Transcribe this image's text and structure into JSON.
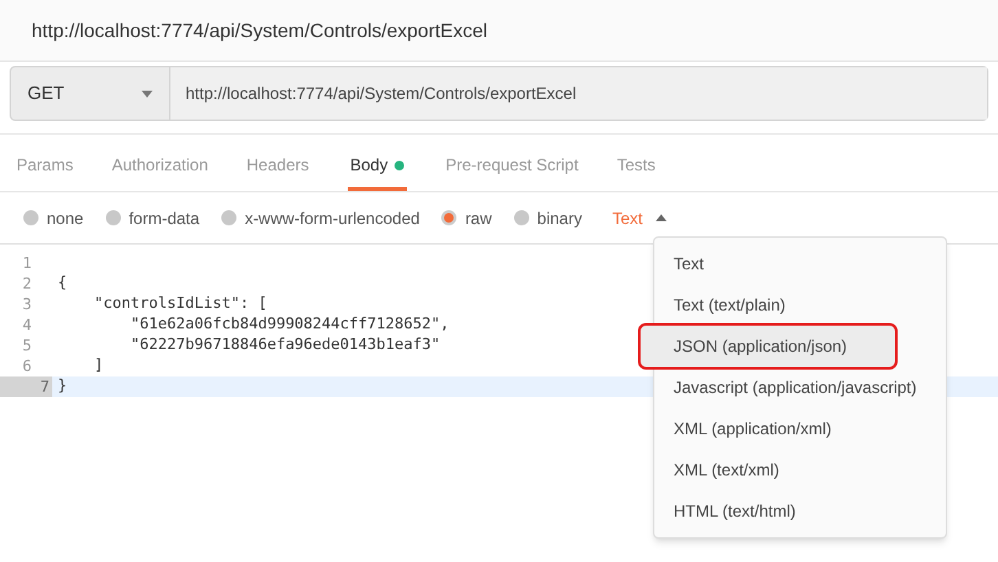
{
  "title": "http://localhost:7774/api/System/Controls/exportExcel",
  "request": {
    "method": "GET",
    "url": "http://localhost:7774/api/System/Controls/exportExcel"
  },
  "tabs": [
    {
      "label": "Params",
      "selected": false,
      "dot": false
    },
    {
      "label": "Authorization",
      "selected": false,
      "dot": false
    },
    {
      "label": "Headers",
      "selected": false,
      "dot": false
    },
    {
      "label": "Body",
      "selected": true,
      "dot": true
    },
    {
      "label": "Pre-request Script",
      "selected": false,
      "dot": false
    },
    {
      "label": "Tests",
      "selected": false,
      "dot": false
    }
  ],
  "body_types": [
    {
      "label": "none",
      "selected": false
    },
    {
      "label": "form-data",
      "selected": false
    },
    {
      "label": "x-www-form-urlencoded",
      "selected": false
    },
    {
      "label": "raw",
      "selected": true
    },
    {
      "label": "binary",
      "selected": false
    }
  ],
  "format_dropdown": {
    "value": "Text",
    "expanded": true
  },
  "editor": {
    "lines": [
      {
        "number": "1",
        "current": false
      },
      {
        "number": "2",
        "text": "{",
        "current": false
      },
      {
        "number": "3",
        "text": "    \"controlsIdList\": [",
        "current": false
      },
      {
        "number": "4",
        "text": "        \"61e62a06fcb84d99908244cff7128652\",",
        "current": false
      },
      {
        "number": "5",
        "text": "        \"62227b96718846efa96ede0143b1eaf3\"",
        "current": false
      },
      {
        "number": "6",
        "text": "    ]",
        "current": false
      },
      {
        "number": "7",
        "text": "}",
        "current": true
      }
    ]
  },
  "menu": [
    {
      "label": "Text",
      "highlighted": false
    },
    {
      "label": "Text (text/plain)",
      "highlighted": false
    },
    {
      "label": "JSON (application/json)",
      "highlighted": true
    },
    {
      "label": "Javascript (application/javascript)",
      "highlighted": false
    },
    {
      "label": "XML (application/xml)",
      "highlighted": false
    },
    {
      "label": "XML (text/xml)",
      "highlighted": false
    },
    {
      "label": "HTML (text/html)",
      "highlighted": false
    }
  ]
}
